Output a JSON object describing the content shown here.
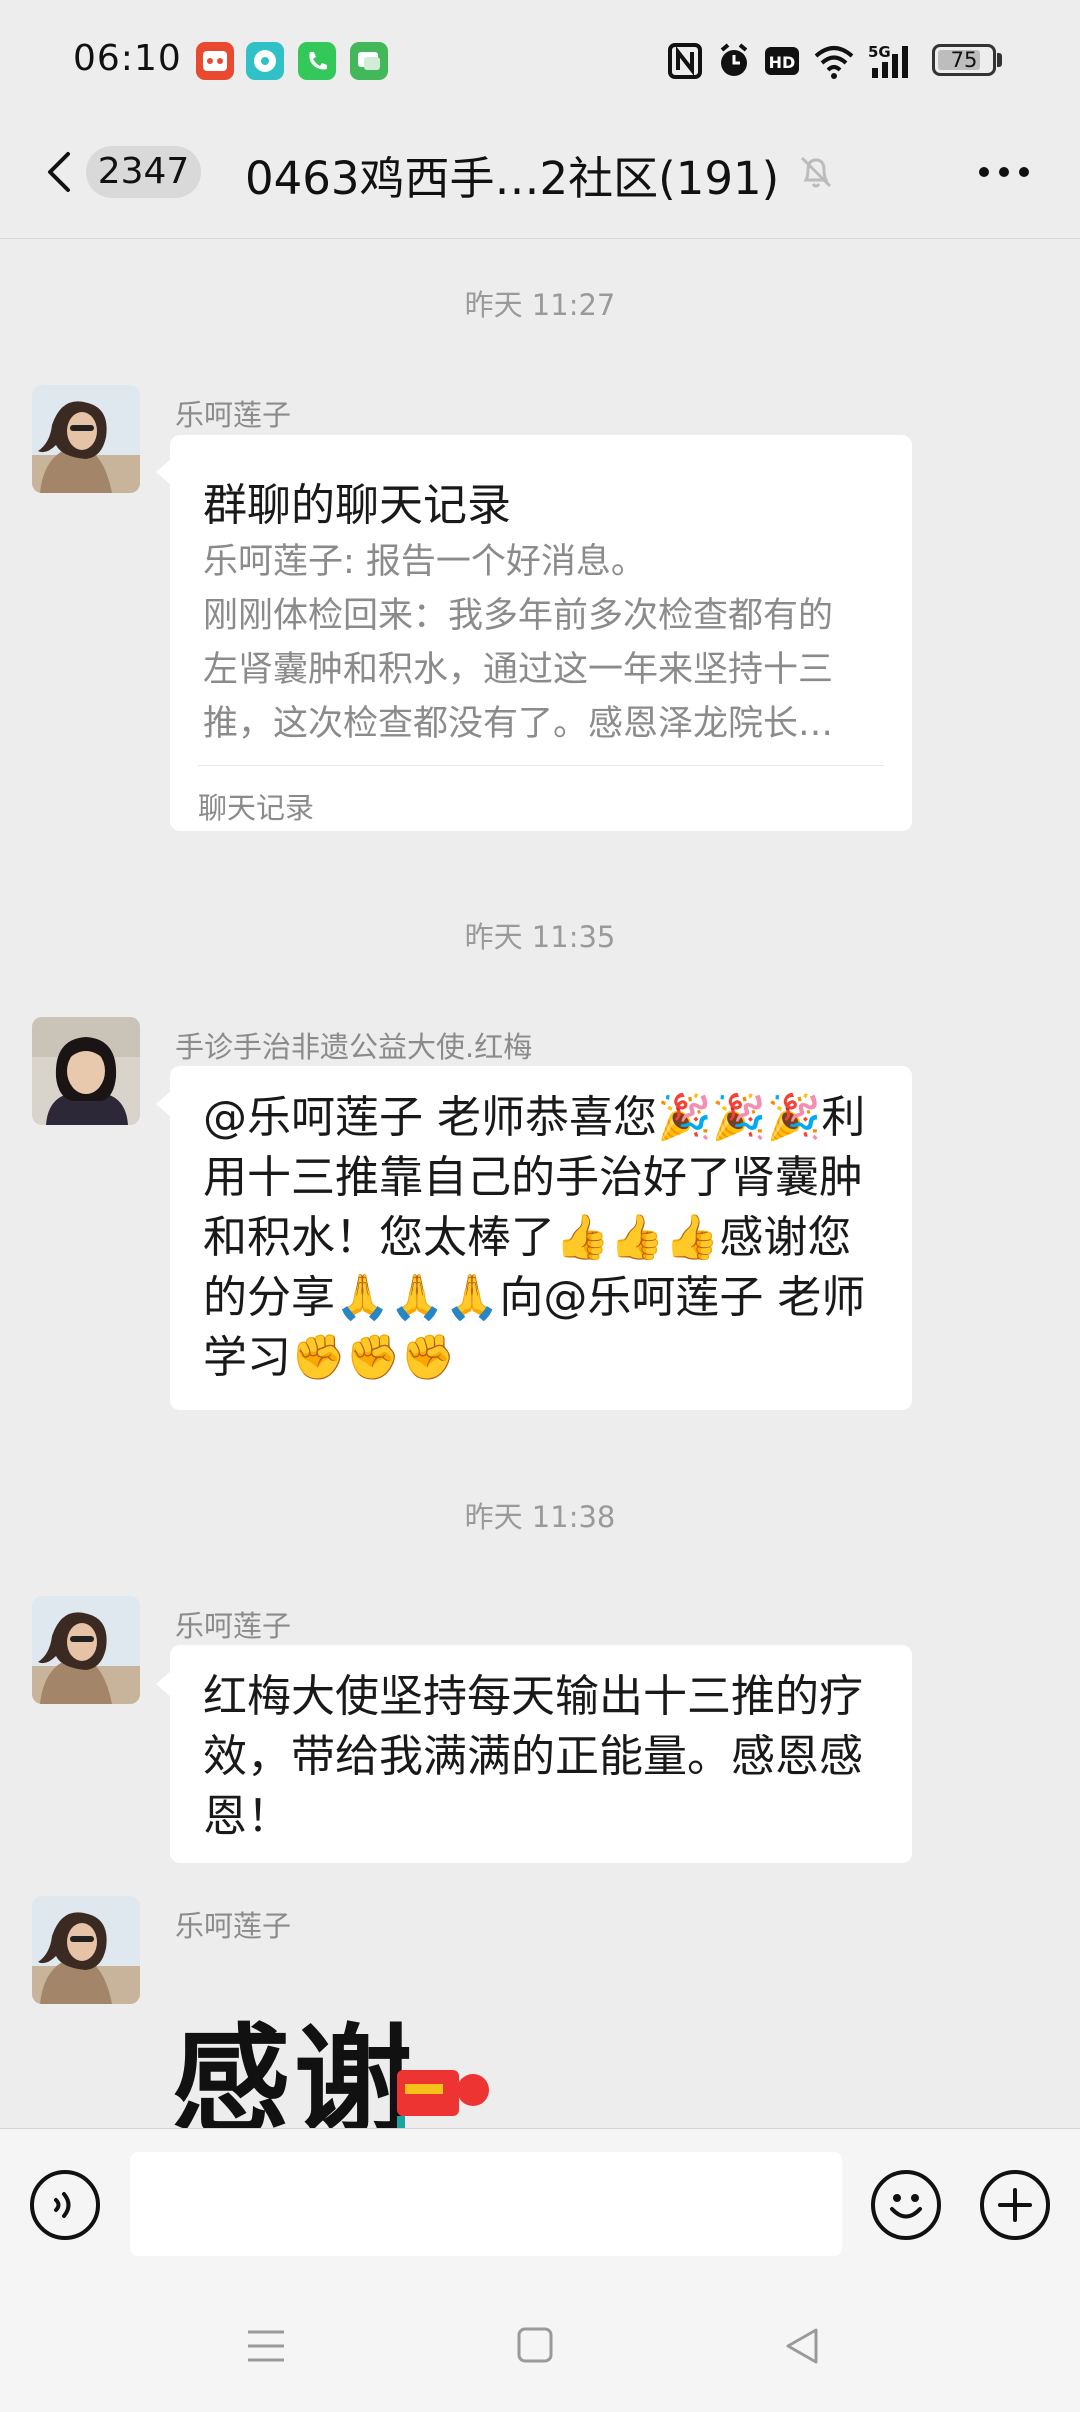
{
  "status_bar": {
    "time": "06:10",
    "app_icons": [
      "taobao-app-icon",
      "message-app-icon",
      "phone-app-icon",
      "chat-app-icon"
    ],
    "indicators": [
      "nfc-icon",
      "alarm-icon",
      "hd-icon",
      "wifi-icon",
      "5g-signal-icon"
    ],
    "network": "5G",
    "battery_level": "75"
  },
  "nav": {
    "unread_count": "2347",
    "title": "0463鸡西手…2社区(191)",
    "icons": [
      "back-icon",
      "mute-bell-icon",
      "more-icon"
    ]
  },
  "messages": [
    {
      "timestamp": "昨天 11:27"
    },
    {
      "sender": "乐呵莲子",
      "type": "chat_record",
      "record_title": "群聊的聊天记录",
      "record_lines": [
        "乐呵莲子: 报告一个好消息。",
        "刚刚体检回来：我多年前多次检查都有的",
        "左肾囊肿和积水，通过这一年来坚持十三",
        "推，这次检查都没有了。感恩泽龙院长…"
      ],
      "record_footer": "聊天记录"
    },
    {
      "timestamp": "昨天 11:35"
    },
    {
      "sender": "手诊手治非遗公益大使.红梅",
      "type": "text",
      "text": "@乐呵莲子  老师恭喜您🎉🎉🎉利用十三推靠自己的手治好了肾囊肿和积水！您太棒了👍👍👍感谢您的分享🙏🙏🙏向@乐呵莲子  老师学习✊✊✊"
    },
    {
      "timestamp": "昨天 11:38"
    },
    {
      "sender": "乐呵莲子",
      "type": "text",
      "text": "红梅大使坚持每天输出十三推的疗效，带给我满满的正能量。感恩感恩！"
    },
    {
      "sender": "乐呵莲子",
      "type": "sticker",
      "sticker_text": "感谢"
    }
  ],
  "input_bar": {
    "placeholder": "",
    "icons": [
      "voice-icon",
      "emoji-icon",
      "plus-icon"
    ]
  },
  "system_nav": {
    "icons": [
      "menu-icon",
      "home-icon",
      "back-triangle-icon"
    ]
  }
}
